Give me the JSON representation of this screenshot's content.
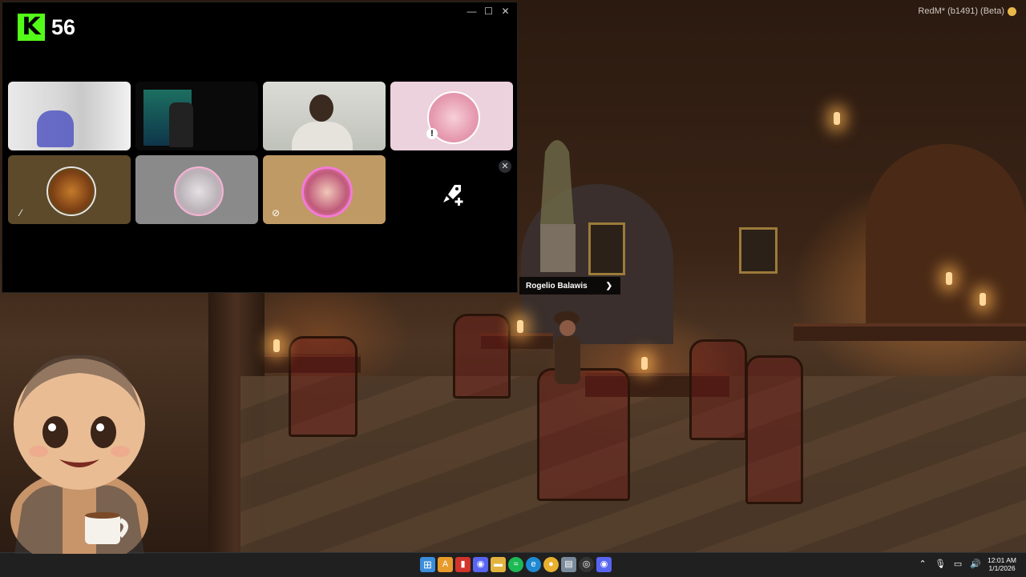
{
  "kick": {
    "viewer_count": "56",
    "logo_letter": "K"
  },
  "game": {
    "window_title": "RedM* (b1491) (Beta)"
  },
  "call_window": {
    "controls": {
      "minimize": "—",
      "maximize": "☐",
      "close": "✕"
    },
    "close_tile_symbol": "✕",
    "invite_symbol": "🚀"
  },
  "nameplate": {
    "name": "Rogelio Balawis",
    "arrow": "❯"
  },
  "taskbar": {
    "icons": [
      "start-icon",
      "file-explorer-icon",
      "office-icon",
      "discord-icon",
      "folder-icon",
      "spotify-icon",
      "edge-icon",
      "chrome-icon",
      "notepad-icon",
      "obs-icon",
      "discord-icon-2"
    ]
  },
  "tray": {
    "time": "12:01 AM",
    "date": "1/1/2026"
  },
  "colors": {
    "kick_green": "#53fc18",
    "taskbar": "#202020",
    "discord_accent": "#5865f2"
  }
}
